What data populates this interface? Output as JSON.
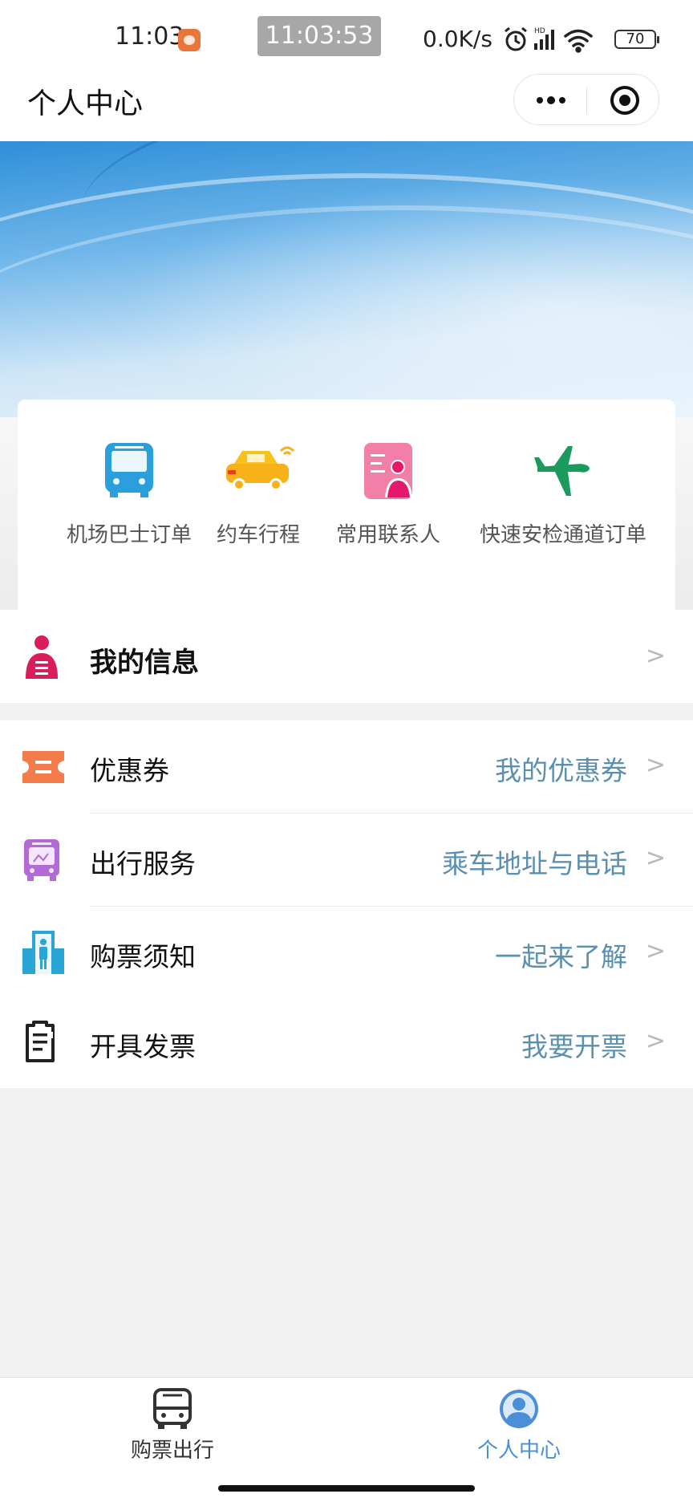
{
  "status_bar": {
    "time": "11:03",
    "clock_badge": "11:03:53",
    "net_speed": "0.0K/s",
    "battery": "70"
  },
  "header": {
    "title": "个人中心"
  },
  "quick_actions": [
    {
      "label": "机场巴士订单",
      "icon": "bus-icon"
    },
    {
      "label": "约车行程",
      "icon": "car-icon"
    },
    {
      "label": "常用联系人",
      "icon": "contacts-icon"
    },
    {
      "label": "快速安检通道订单",
      "icon": "airplane-icon"
    }
  ],
  "my_info": {
    "label": "我的信息",
    "chevron": ">"
  },
  "menu": [
    {
      "label": "优惠券",
      "value": "我的优惠券",
      "icon": "coupon-icon",
      "icon_color": "#f47c4a"
    },
    {
      "label": "出行服务",
      "value": "乘车地址与电话",
      "icon": "bus-front-icon",
      "icon_color": "#b369d6"
    },
    {
      "label": "购票须知",
      "value": "一起来了解",
      "icon": "person-info-icon",
      "icon_color": "#2aa6d6"
    },
    {
      "label": "开具发票",
      "value": "我要开票",
      "icon": "invoice-icon",
      "icon_color": "#222222"
    }
  ],
  "tabs": [
    {
      "label": "购票出行",
      "icon": "bus-tab-icon",
      "active": false
    },
    {
      "label": "个人中心",
      "icon": "profile-tab-icon",
      "active": true
    }
  ],
  "colors": {
    "accent_value": "#5b8fb0",
    "tab_active": "#4a8fd8",
    "tab_inactive": "#333333"
  }
}
